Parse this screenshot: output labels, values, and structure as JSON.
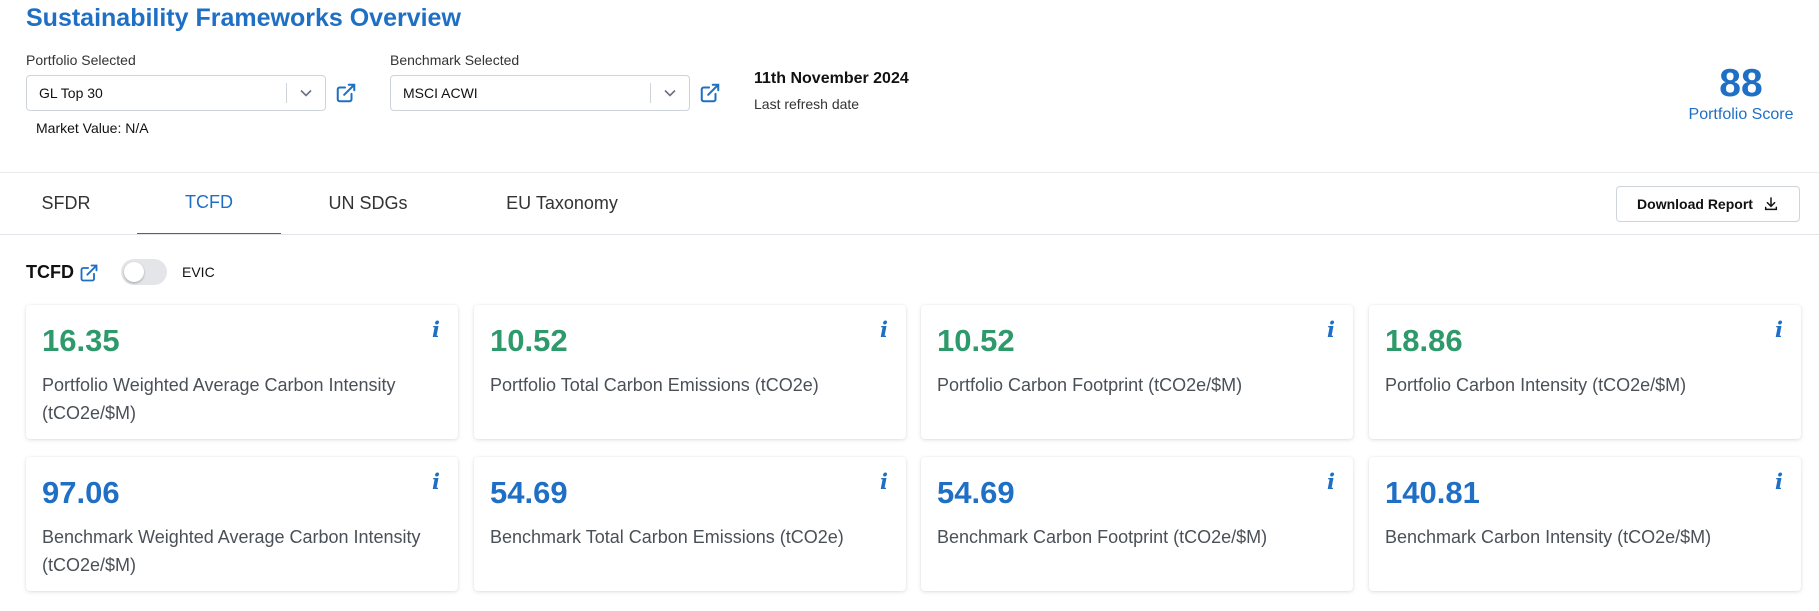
{
  "header": {
    "title": "Sustainability Frameworks Overview",
    "portfolio_label": "Portfolio Selected",
    "portfolio_value": "GL Top 30",
    "benchmark_label": "Benchmark Selected",
    "benchmark_value": "MSCI ACWI",
    "market_value": "Market Value: N/A",
    "date": "11th November 2024",
    "refresh_label": "Last refresh date",
    "score_value": "88",
    "score_label": "Portfolio Score"
  },
  "tabs": [
    {
      "label": "SFDR",
      "active": false
    },
    {
      "label": "TCFD",
      "active": true
    },
    {
      "label": "UN SDGs",
      "active": false
    },
    {
      "label": "EU Taxonomy",
      "active": false
    }
  ],
  "download_label": "Download Report",
  "section": {
    "title": "TCFD",
    "toggle_label": "EVIC",
    "toggle_on": false
  },
  "cards": [
    {
      "value": "16.35",
      "label": "Portfolio Weighted Average Carbon Intensity (tCO2e/$M)",
      "color": "#2e9a6b"
    },
    {
      "value": "10.52",
      "label": "Portfolio Total Carbon Emissions (tCO2e)",
      "color": "#2e9a6b"
    },
    {
      "value": "10.52",
      "label": "Portfolio Carbon Footprint (tCO2e/$M)",
      "color": "#2e9a6b"
    },
    {
      "value": "18.86",
      "label": "Portfolio Carbon Intensity (tCO2e/$M)",
      "color": "#2e9a6b"
    },
    {
      "value": "97.06",
      "label": "Benchmark Weighted Average Carbon Intensity (tCO2e/$M)",
      "color": "#1f6fc5"
    },
    {
      "value": "54.69",
      "label": "Benchmark Total Carbon Emissions (tCO2e)",
      "color": "#1f6fc5"
    },
    {
      "value": "54.69",
      "label": "Benchmark Carbon Footprint (tCO2e/$M)",
      "color": "#1f6fc5"
    },
    {
      "value": "140.81",
      "label": "Benchmark Carbon Intensity (tCO2e/$M)",
      "color": "#1f6fc5"
    }
  ],
  "info_glyph": "i",
  "colors": {
    "accent": "#1f6fc5",
    "positive": "#2e9a6b"
  }
}
